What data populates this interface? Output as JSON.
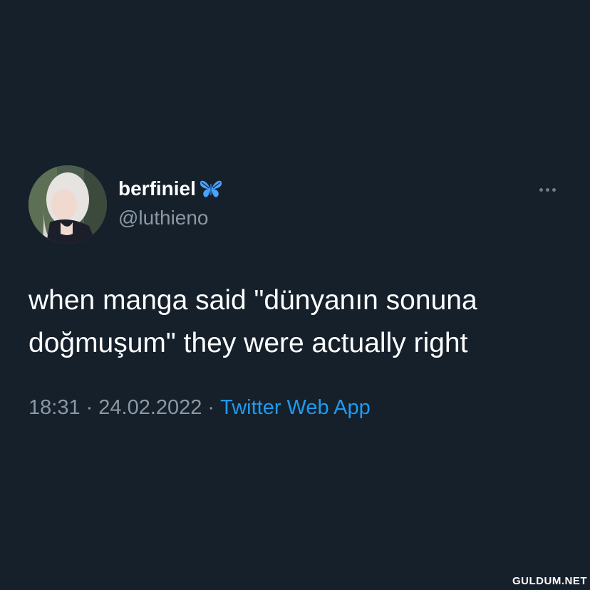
{
  "tweet": {
    "display_name": "berfiniel",
    "badge_icon": "butterfly-icon",
    "handle": "@luthieno",
    "text_line1": "when manga said \"dünyanın sonuna",
    "text_line2": "doğmuşum\" they were actually right",
    "time": "18:31",
    "separator": "·",
    "date": "24.02.2022",
    "source": "Twitter Web App",
    "more_icon": "more-horizontal-icon"
  },
  "watermark": "GULDUM.NET",
  "colors": {
    "background": "#15202b",
    "text": "#ffffff",
    "secondary": "#8b98a5",
    "accent": "#1d9bf0",
    "badge": "#4aa3ff"
  }
}
